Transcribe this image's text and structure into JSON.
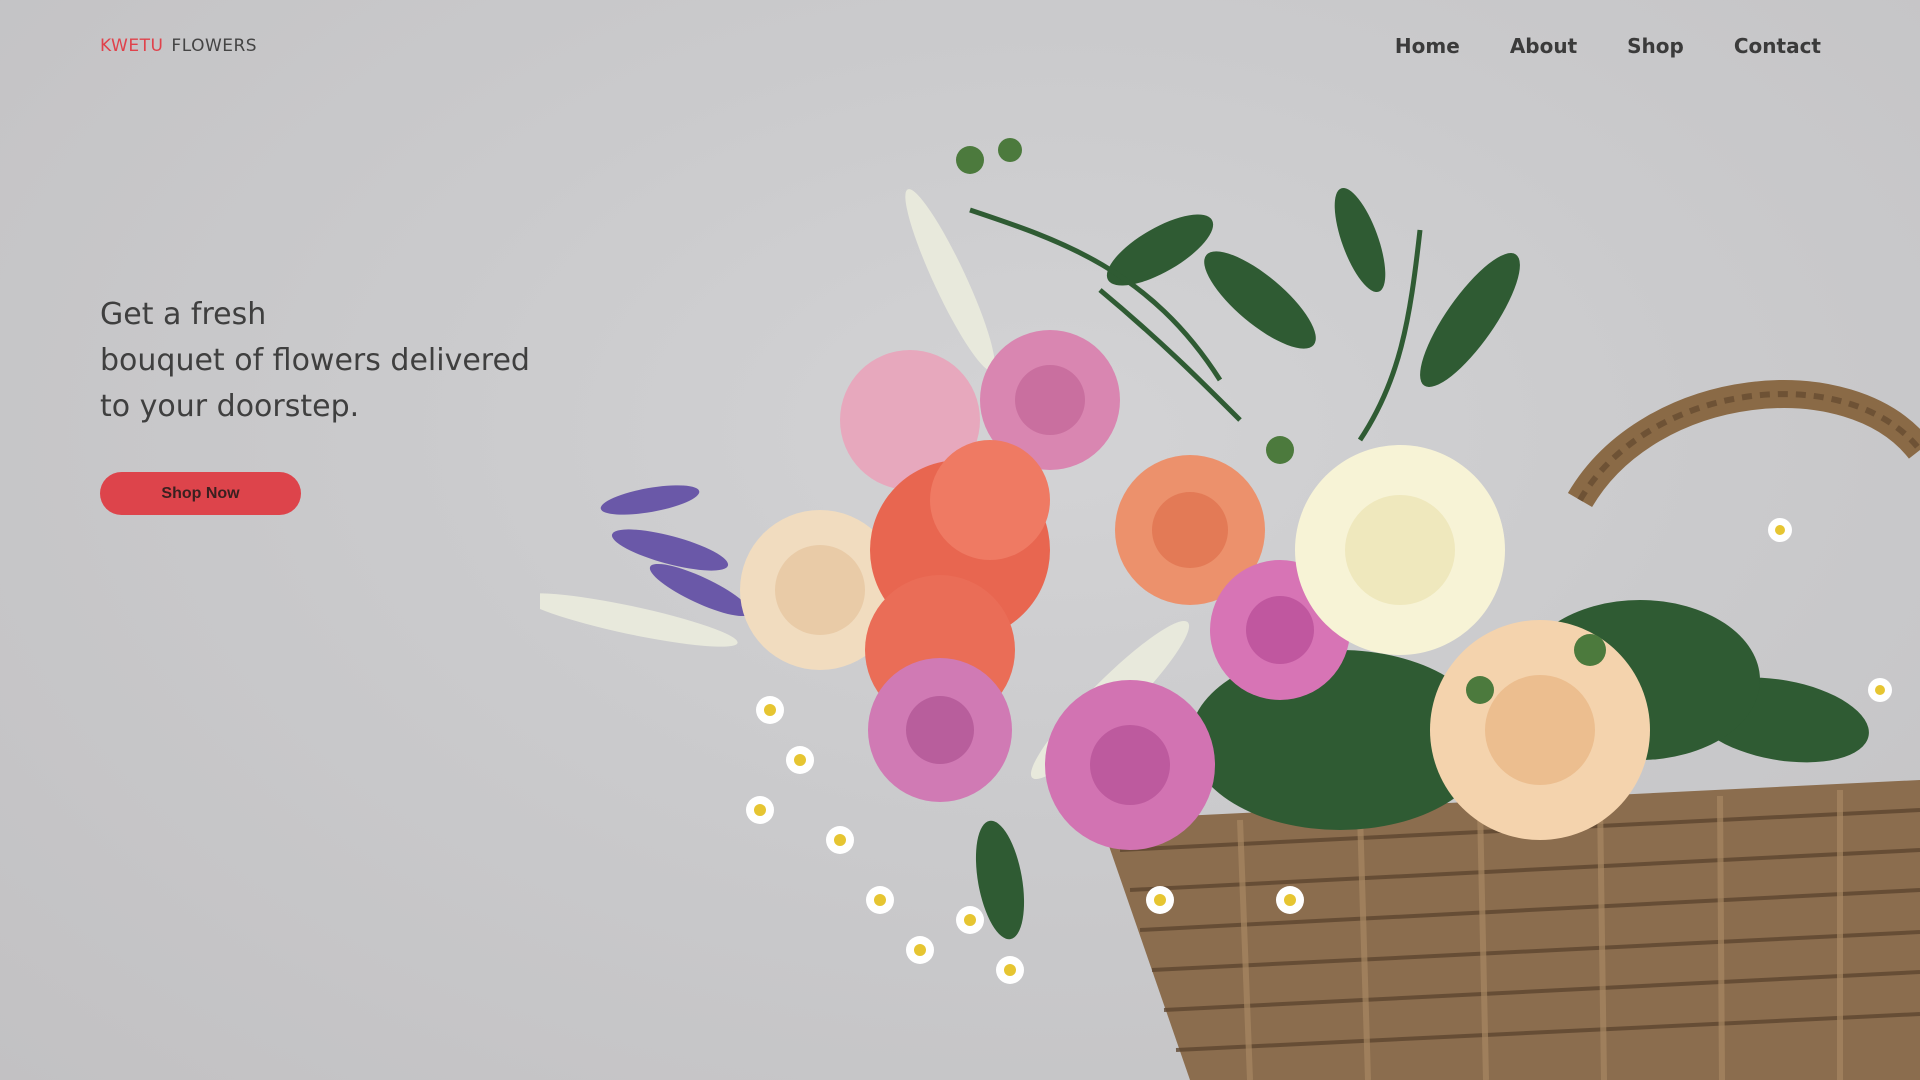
{
  "header": {
    "logo_brand": "KWETU",
    "logo_rest": "FLOWERS",
    "nav": [
      {
        "label": "Home"
      },
      {
        "label": "About"
      },
      {
        "label": "Shop"
      },
      {
        "label": "Contact"
      }
    ]
  },
  "hero": {
    "lines": [
      "Get a fresh",
      "bouquet of flowers delivered",
      "to your doorstep."
    ],
    "cta_label": "Shop Now"
  },
  "colors": {
    "accent": "#dd444b",
    "background": "#cacacc",
    "text": "#3f3f3f"
  },
  "image": {
    "subject": "flower-bouquet-in-wicker-basket"
  }
}
